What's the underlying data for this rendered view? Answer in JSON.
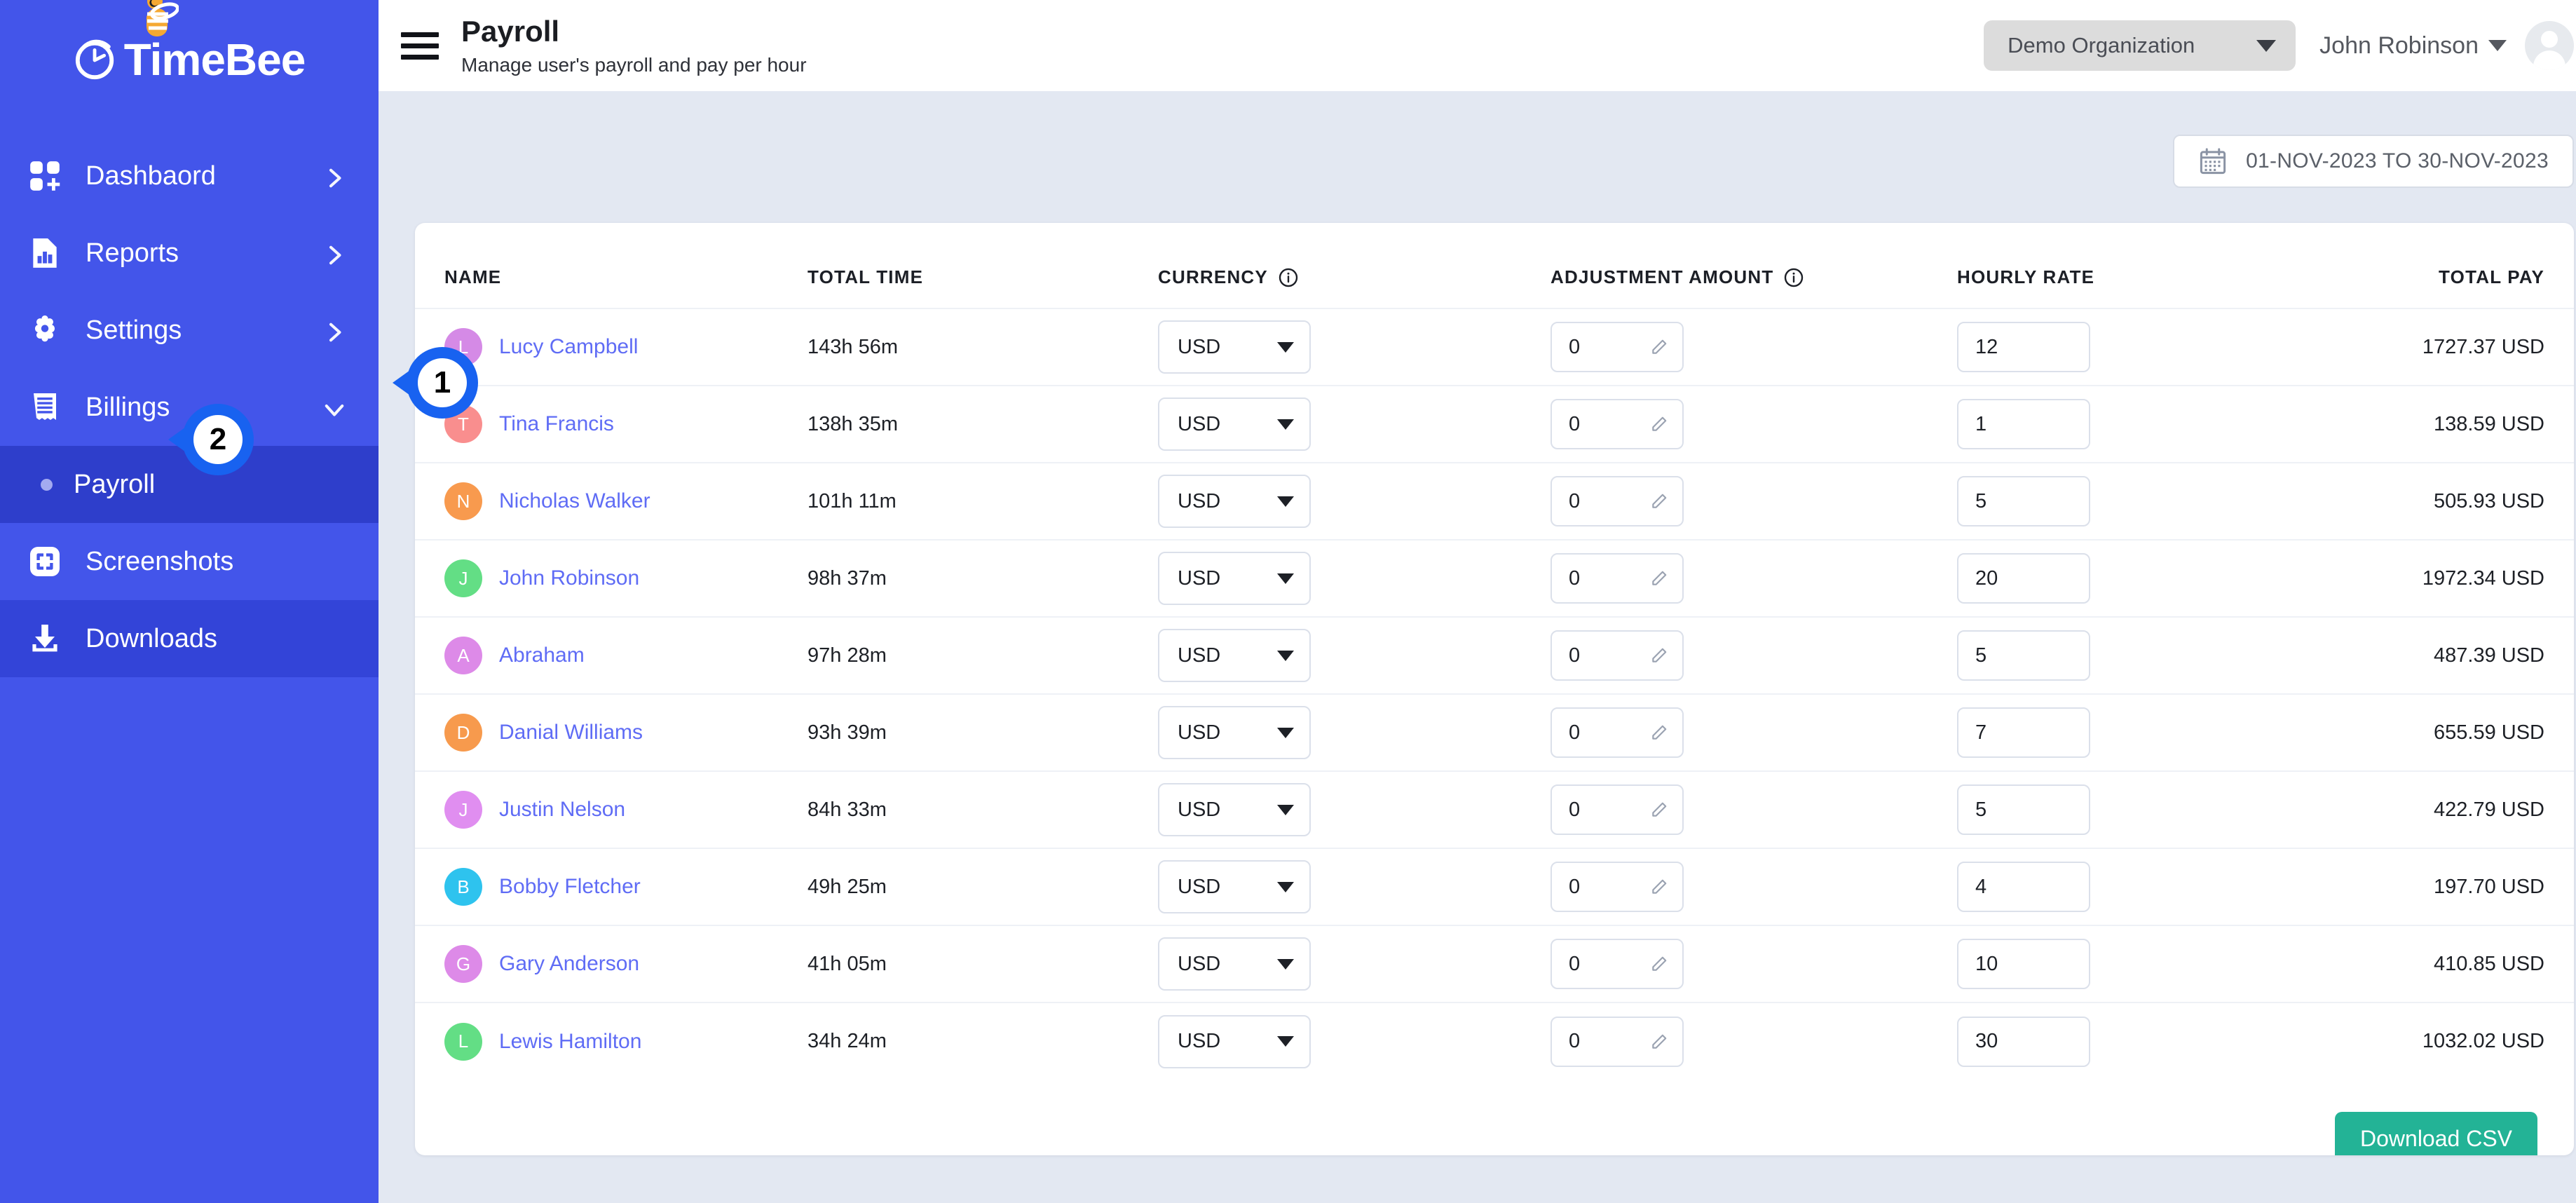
{
  "brand": {
    "name": "TimeBee",
    "logo_icon": "clock-icon",
    "bee_icon": "bee-icon"
  },
  "sidebar": {
    "items": [
      {
        "label": "Dashbaord",
        "icon": "dashboard-grid-icon",
        "chevron": "chevron-right",
        "active": false
      },
      {
        "label": "Reports",
        "icon": "report-document-icon",
        "chevron": "chevron-right",
        "active": false
      },
      {
        "label": "Settings",
        "icon": "gear-icon",
        "chevron": "chevron-right",
        "active": false
      },
      {
        "label": "Billings",
        "icon": "invoice-icon",
        "chevron": "chevron-down",
        "active": false
      }
    ],
    "sub_item": {
      "label": "Payroll",
      "active": true
    },
    "items_after": [
      {
        "label": "Screenshots",
        "icon": "crop-frame-icon",
        "chevron": "",
        "active": false
      },
      {
        "label": "Downloads",
        "icon": "download-icon",
        "chevron": "",
        "active": true
      }
    ]
  },
  "header": {
    "menu_icon": "hamburger-icon",
    "title": "Payroll",
    "subtitle": "Manage user's payroll and pay per hour",
    "organization": "Demo Organization",
    "org_caret_icon": "chevron-down-icon",
    "user_name": "John Robinson",
    "user_caret_icon": "chevron-down-icon",
    "avatar_icon": "user-avatar-icon"
  },
  "filters": {
    "calendar_icon": "calendar-icon",
    "date_range": "01-NOV-2023 TO 30-NOV-2023"
  },
  "table": {
    "columns": [
      {
        "label": "NAME",
        "info": false
      },
      {
        "label": "TOTAL TIME",
        "info": false
      },
      {
        "label": "CURRENCY",
        "info": true
      },
      {
        "label": "ADJUSTMENT AMOUNT",
        "info": true
      },
      {
        "label": "HOURLY RATE",
        "info": false
      },
      {
        "label": "TOTAL PAY",
        "info": false
      }
    ],
    "info_icon": "info-circle-icon",
    "edit_icon": "pencil-icon",
    "rows": [
      {
        "initial": "L",
        "avatar_color": "#d58ae6",
        "name": "Lucy Campbell",
        "total_time": "143h 56m",
        "currency": "USD",
        "adjustment": "0",
        "hourly_rate": "12",
        "total_pay": "1727.37 USD"
      },
      {
        "initial": "T",
        "avatar_color": "#f98e8e",
        "name": "Tina Francis",
        "total_time": "138h 35m",
        "currency": "USD",
        "adjustment": "0",
        "hourly_rate": "1",
        "total_pay": "138.59 USD"
      },
      {
        "initial": "N",
        "avatar_color": "#f89a4e",
        "name": "Nicholas Walker",
        "total_time": "101h 11m",
        "currency": "USD",
        "adjustment": "0",
        "hourly_rate": "5",
        "total_pay": "505.93 USD"
      },
      {
        "initial": "J",
        "avatar_color": "#63de85",
        "name": "John Robinson",
        "total_time": "98h 37m",
        "currency": "USD",
        "adjustment": "0",
        "hourly_rate": "20",
        "total_pay": "1972.34 USD"
      },
      {
        "initial": "A",
        "avatar_color": "#dd8ae8",
        "name": "Abraham",
        "total_time": "97h 28m",
        "currency": "USD",
        "adjustment": "0",
        "hourly_rate": "5",
        "total_pay": "487.39 USD"
      },
      {
        "initial": "D",
        "avatar_color": "#f79a4d",
        "name": "Danial Williams",
        "total_time": "93h 39m",
        "currency": "USD",
        "adjustment": "0",
        "hourly_rate": "7",
        "total_pay": "655.59 USD"
      },
      {
        "initial": "J",
        "avatar_color": "#e08ef0",
        "name": "Justin Nelson",
        "total_time": "84h 33m",
        "currency": "USD",
        "adjustment": "0",
        "hourly_rate": "5",
        "total_pay": "422.79 USD"
      },
      {
        "initial": "B",
        "avatar_color": "#2ec3ee",
        "name": "Bobby Fletcher",
        "total_time": "49h 25m",
        "currency": "USD",
        "adjustment": "0",
        "hourly_rate": "4",
        "total_pay": "197.70 USD"
      },
      {
        "initial": "G",
        "avatar_color": "#dd8ae8",
        "name": "Gary Anderson",
        "total_time": "41h 05m",
        "currency": "USD",
        "adjustment": "0",
        "hourly_rate": "10",
        "total_pay": "410.85 USD"
      },
      {
        "initial": "L",
        "avatar_color": "#63de85",
        "name": "Lewis Hamilton",
        "total_time": "34h 24m",
        "currency": "USD",
        "adjustment": "0",
        "hourly_rate": "30",
        "total_pay": "1032.02 USD"
      }
    ]
  },
  "actions": {
    "download_csv": "Download CSV"
  },
  "callouts": [
    {
      "number": "1"
    },
    {
      "number": "2"
    }
  ],
  "colors": {
    "sidebar_bg": "#4355ea",
    "sidebar_active": "#2e3ecb",
    "content_bg": "#e3e8f2",
    "accent_link": "#5f6cf5",
    "csv_button": "#23b396",
    "callout": "#1862f0"
  }
}
